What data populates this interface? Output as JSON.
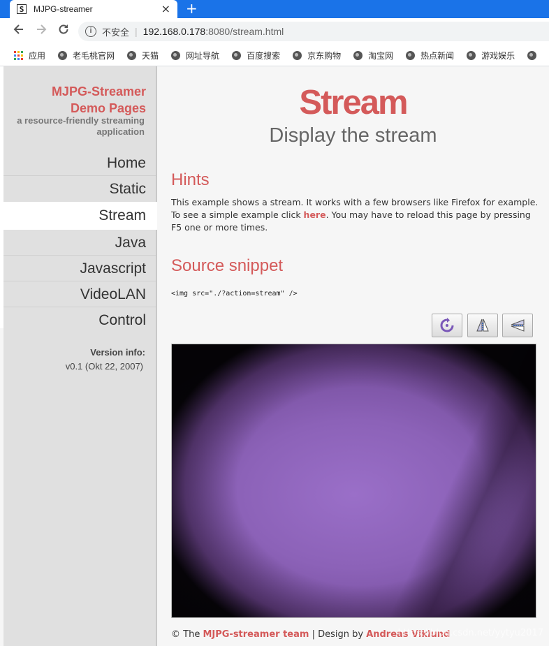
{
  "browser": {
    "tab_title": "MJPG-streamer",
    "favicon_letter": "S",
    "tab_close": "×",
    "new_tab": "+",
    "security_label": "不安全",
    "url_host": "192.168.0.178",
    "url_rest": ":8080/stream.html",
    "bookmarks": [
      "应用",
      "老毛桃官网",
      "天猫",
      "网址导航",
      "百度搜索",
      "京东购物",
      "淘宝网",
      "热点新闻",
      "游戏娱乐"
    ]
  },
  "sidebar": {
    "brand_line1": "MJPG-Streamer",
    "brand_line2": "Demo Pages",
    "tagline": "a resource-friendly streaming application",
    "menu": [
      {
        "label": "Home"
      },
      {
        "label": "Static"
      },
      {
        "label": "Stream"
      },
      {
        "label": "Java"
      },
      {
        "label": "Javascript"
      },
      {
        "label": "VideoLAN"
      },
      {
        "label": "Control"
      }
    ],
    "version_title": "Version info:",
    "version_value": "v0.1 (Okt 22, 2007)"
  },
  "content": {
    "title": "Stream",
    "subtitle": "Display the stream",
    "hints_heading": "Hints",
    "hints_text_1": "This example shows a stream. It works with a few browsers like Firefox for example. To see a simple example click ",
    "hints_link": "here",
    "hints_text_2": ". You may have to reload this page by pressing F5 one or more times.",
    "snippet_heading": "Source snippet",
    "snippet_code": "<img src=\"./?action=stream\" />",
    "footer_prefix": "© The ",
    "footer_team": "MJPG-streamer team",
    "footer_mid": " | Design by ",
    "footer_designer": "Andreas Viklund",
    "watermark": "https://blog.csdn.net/yytyu2017"
  },
  "colors": {
    "accent": "#d45a5a",
    "chrome_blue": "#1a73e8",
    "sidebar_bg": "#e0e0e0"
  },
  "icons": {
    "rotate": "rotate-icon",
    "flip_vertical": "flip-vertical-icon",
    "flip_horizontal": "flip-horizontal-icon"
  }
}
